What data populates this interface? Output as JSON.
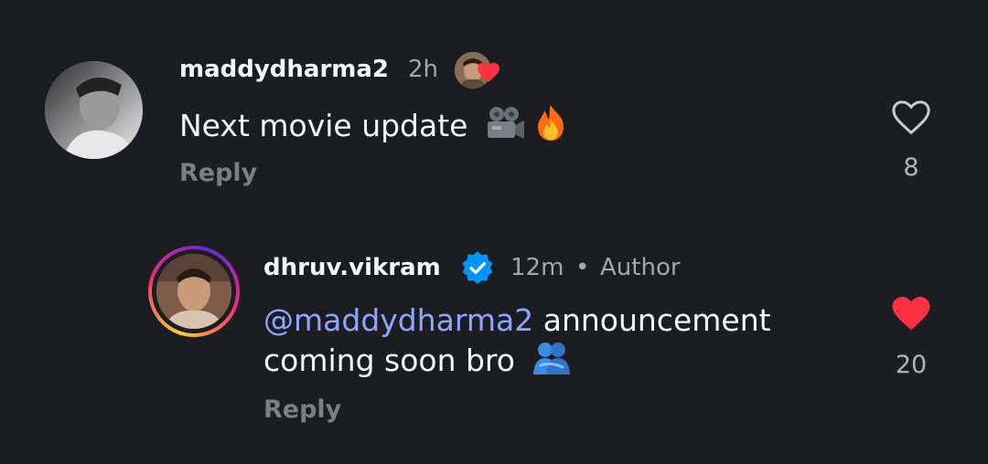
{
  "comments": [
    {
      "username": "maddydharma2",
      "time": "2h",
      "text": "Next movie update",
      "emojis": [
        "movie-camera",
        "fire"
      ],
      "reply_label": "Reply",
      "like_count": "8",
      "liked": false
    },
    {
      "username": "dhruv.vikram",
      "verified": true,
      "time": "12m",
      "separator": "•",
      "role_badge": "Author",
      "mention": "@maddydharma2",
      "text_line1": " announcement",
      "text_line2": "coming soon bro",
      "emojis": [
        "people-hugging"
      ],
      "reply_label": "Reply",
      "like_count": "20",
      "liked": true
    }
  ],
  "colors": {
    "background": "#1c1d21",
    "liked_heart": "#ff3040",
    "mention": "#8fa4ff",
    "verified": "#0095f6"
  }
}
